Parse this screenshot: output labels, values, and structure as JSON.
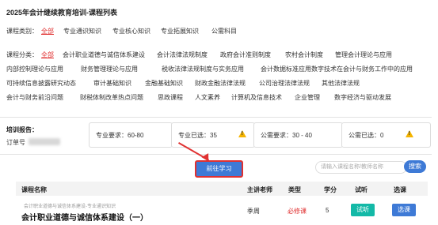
{
  "page_title": "2025年会计继续教育培训-课程列表",
  "course_category": {
    "label": "课程类别：",
    "items": [
      "全部",
      "专业通识知识",
      "专业核心知识",
      "专业拓展知识",
      "公需科目"
    ],
    "active_index": 0
  },
  "course_type": {
    "label": "课程分类：",
    "rows": [
      [
        "全部",
        "会计职业道德与诚信体系建设",
        "会计法律法规制度",
        "政府会计准则制度",
        "农村会计制度",
        "管理会计理论与应用"
      ],
      [
        "内部控制理论与应用",
        "财务管理理论与应用",
        "税收法律法规制度与实务应用",
        "会计数据标准应用",
        "数字技术在会计与财务工作中的应用"
      ],
      [
        "可持续信息披露研究动态",
        "审计基础知识",
        "金融基础知识",
        "财政金融法律法规",
        "公司治理法律法规",
        "其他法律法规"
      ],
      [
        "会计与财务前沿问题",
        "财税体制改革热点问题",
        "思政课程",
        "人文素养",
        "计算机及信息技术",
        "企业管理",
        "数字经济与驱动发展"
      ]
    ],
    "active": "全部"
  },
  "report": {
    "label": "培训报告：",
    "order_label": "订单号",
    "order_value": "████"
  },
  "stats": {
    "professional_req": "专业要求：60-80",
    "professional_selected": "专业已选：35",
    "public_req": "公需要求：30 - 40",
    "public_selected": "公需已选：0"
  },
  "go_study_label": "前往学习",
  "search": {
    "placeholder": "请输入课程名称/教师名称",
    "button": "搜索"
  },
  "table": {
    "headers": [
      "课程名称",
      "主讲老师",
      "类型",
      "学分",
      "试听",
      "选课"
    ],
    "rows": [
      {
        "subtitle": "会计职业道德与诚信体系建设-专业通识知识",
        "title": "会计职业道德与诚信体系建设（一）",
        "teacher": "季周",
        "type": "必修课",
        "credits": "5",
        "trial": "试听",
        "select": "选课"
      }
    ]
  },
  "colors": {
    "accent_red": "#e03131",
    "primary_blue": "#3e7ad6",
    "trial_green": "#13b9a7",
    "warning_yellow": "#f5b400"
  }
}
